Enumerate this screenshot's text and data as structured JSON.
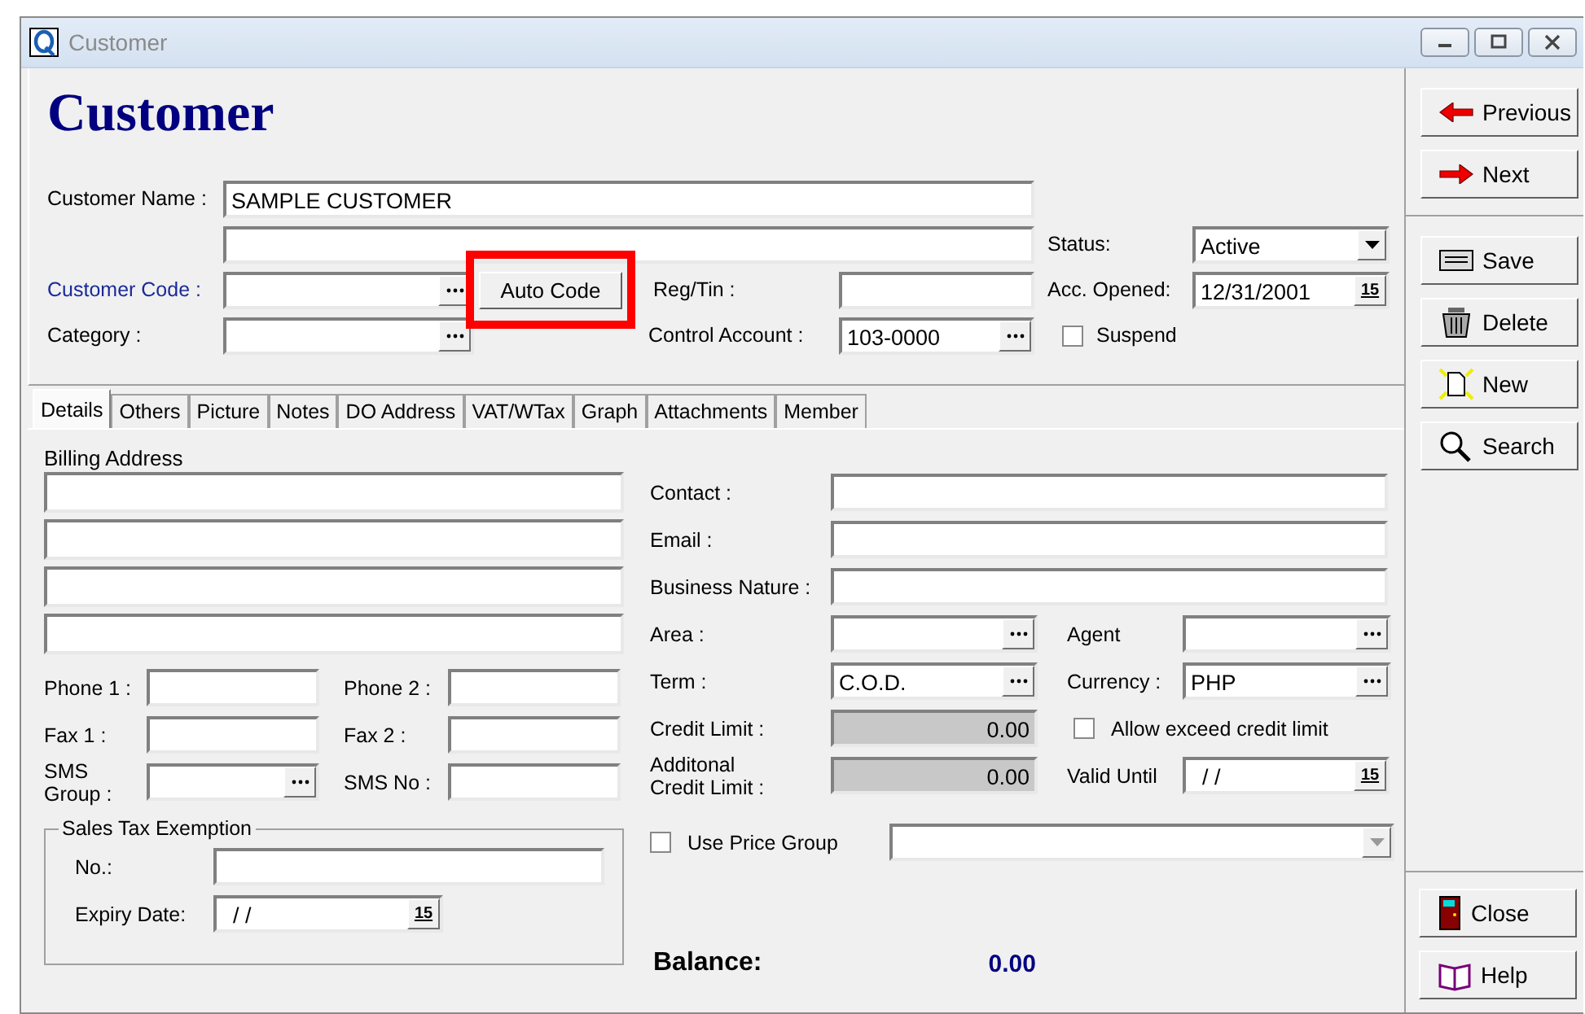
{
  "window": {
    "title": "Customer"
  },
  "heading": "Customer",
  "customer_name": {
    "label": "Customer Name :",
    "value": "SAMPLE CUSTOMER"
  },
  "status": {
    "label": "Status:",
    "value": "Active"
  },
  "customer_code": {
    "label": "Customer Code :"
  },
  "auto_code_button": {
    "label": "Auto Code",
    "highlighted": true
  },
  "reg_tin": {
    "label": "Reg/Tin :"
  },
  "acc_opened": {
    "label": "Acc. Opened:",
    "value": "12/31/2001",
    "calendar_text": "15"
  },
  "category": {
    "label": "Category :"
  },
  "control_account": {
    "label": "Control Account :",
    "value": "103-0000"
  },
  "suspend": {
    "label": "Suspend",
    "checked": false
  },
  "tabs": [
    {
      "label": "Details",
      "selected": true
    },
    {
      "label": "Others",
      "selected": false
    },
    {
      "label": "Picture",
      "selected": false
    },
    {
      "label": "Notes",
      "selected": false
    },
    {
      "label": "DO Address",
      "selected": false
    },
    {
      "label": "VAT/WTax",
      "selected": false
    },
    {
      "label": "Graph",
      "selected": false
    },
    {
      "label": "Attachments",
      "selected": false
    },
    {
      "label": "Member",
      "selected": false
    }
  ],
  "details": {
    "billing_address": {
      "label": "Billing Address"
    },
    "phone_1": {
      "label": "Phone 1 :"
    },
    "phone_2": {
      "label": "Phone 2 :"
    },
    "fax_1": {
      "label": "Fax 1 :"
    },
    "fax_2": {
      "label": "Fax 2 :"
    },
    "sms_group": {
      "label": "SMS Group :"
    },
    "sms_no": {
      "label": "SMS No :"
    },
    "sales_tax_exemption": {
      "title": "Sales Tax Exemption",
      "no_label": "No.:",
      "expiry_label": "Expiry Date:",
      "expiry_value": "/ /",
      "calendar_text": "15"
    },
    "contact": {
      "label": "Contact :"
    },
    "email": {
      "label": "Email :"
    },
    "business_nature": {
      "label": "Business Nature :"
    },
    "area": {
      "label": "Area :"
    },
    "agent": {
      "label": "Agent"
    },
    "term": {
      "label": "Term :",
      "value": "C.O.D."
    },
    "currency": {
      "label": "Currency :",
      "value": "PHP"
    },
    "credit_limit": {
      "label": "Credit Limit :",
      "value": "0.00",
      "disabled": true
    },
    "allow_exceed": {
      "label": "Allow exceed credit limit",
      "checked": false
    },
    "additional_credit_limit": {
      "label": "Additonal Credit Limit :",
      "value": "0.00",
      "disabled": true
    },
    "valid_until": {
      "label": "Valid Until",
      "value": "/ /",
      "calendar_text": "15"
    },
    "use_price_group": {
      "label": "Use Price Group",
      "checked": false
    },
    "balance": {
      "label": "Balance:",
      "value": "0.00"
    }
  },
  "nav_buttons": [
    {
      "label": "Previous",
      "kind": "previous"
    },
    {
      "label": "Next",
      "kind": "next"
    }
  ],
  "record_buttons": [
    {
      "label": "Save",
      "kind": "save"
    },
    {
      "label": "Delete",
      "kind": "delete"
    },
    {
      "label": "New",
      "kind": "new"
    },
    {
      "label": "Search",
      "kind": "search"
    }
  ],
  "bottom_buttons": [
    {
      "label": "Close",
      "kind": "close"
    },
    {
      "label": "Help",
      "kind": "help"
    }
  ]
}
